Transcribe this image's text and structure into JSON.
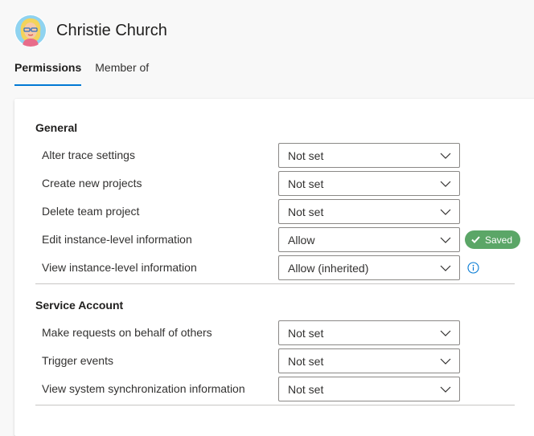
{
  "user": {
    "name": "Christie Church"
  },
  "tabs": [
    {
      "label": "Permissions",
      "active": true
    },
    {
      "label": "Member of",
      "active": false
    }
  ],
  "sections": [
    {
      "title": "General",
      "permissions": [
        {
          "label": "Alter trace settings",
          "value": "Not set"
        },
        {
          "label": "Create new projects",
          "value": "Not set"
        },
        {
          "label": "Delete team project",
          "value": "Not set"
        },
        {
          "label": "Edit instance-level information",
          "value": "Allow",
          "status": "Saved"
        },
        {
          "label": "View instance-level information",
          "value": "Allow (inherited)",
          "icon": "info-icon"
        }
      ]
    },
    {
      "title": "Service Account",
      "permissions": [
        {
          "label": "Make requests on behalf of others",
          "value": "Not set"
        },
        {
          "label": "Trigger events",
          "value": "Not set"
        },
        {
          "label": "View system synchronization information",
          "value": "Not set"
        }
      ]
    }
  ],
  "colors": {
    "accent": "#0078d4",
    "saved_badge": "#5ba667",
    "border": "#8a8886"
  }
}
